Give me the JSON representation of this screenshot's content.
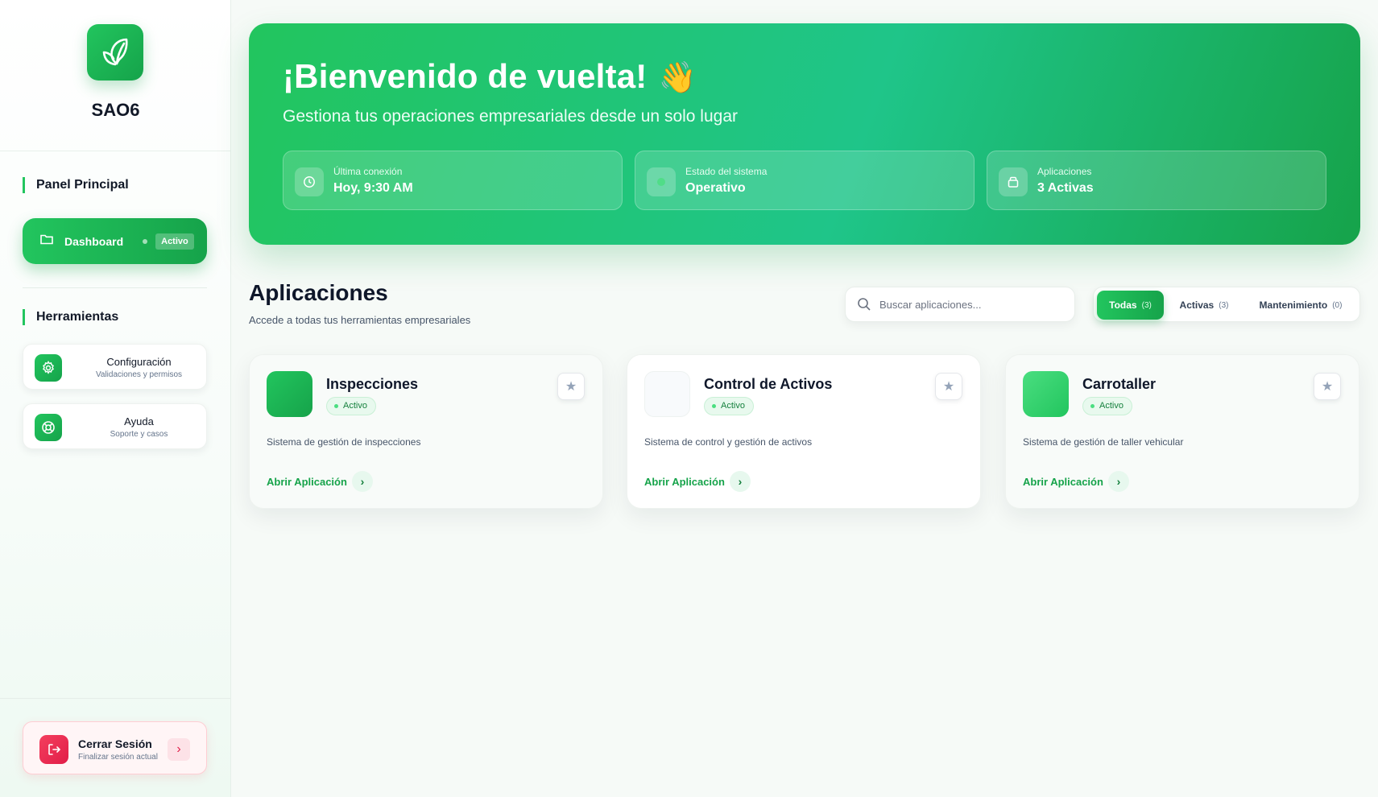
{
  "brand": {
    "name": "SAO6",
    "logo_icon": "leaf-icon"
  },
  "sidebar": {
    "main_section": "Panel Principal",
    "dashboard": {
      "label": "Dashboard",
      "badge": "Activo",
      "icon": "folder-icon"
    },
    "tools_section": "Herramientas",
    "tools": [
      {
        "title": "Configuración",
        "subtitle": "Validaciones y permisos",
        "icon": "gear-icon"
      },
      {
        "title": "Ayuda",
        "subtitle": "Soporte y casos",
        "icon": "lifebuoy-icon"
      }
    ],
    "logout": {
      "title": "Cerrar Sesión",
      "subtitle": "Finalizar sesión actual",
      "icon": "logout-icon",
      "arrow": "›"
    }
  },
  "hero": {
    "title": "¡Bienvenido de vuelta!",
    "wave": "👋",
    "subtitle": "Gestiona tus operaciones empresariales desde un solo lugar",
    "stats": [
      {
        "label": "Última conexión",
        "value": "Hoy, 9:30 AM",
        "icon": "clock-icon"
      },
      {
        "label": "Estado del sistema",
        "value": "Operativo",
        "icon": "status-dot-icon"
      },
      {
        "label": "Aplicaciones",
        "value": "3 Activas",
        "icon": "box-icon"
      }
    ]
  },
  "apps": {
    "title": "Aplicaciones",
    "subtitle": "Accede a todas tus herramientas empresariales",
    "search_placeholder": "Buscar aplicaciones...",
    "filters": [
      {
        "label": "Todas",
        "count": "(3)"
      },
      {
        "label": "Activas",
        "count": "(3)"
      },
      {
        "label": "Mantenimiento",
        "count": "(0)"
      }
    ],
    "cards": [
      {
        "name": "Inspecciones",
        "status": "Activo",
        "description": "Sistema de gestión de inspecciones",
        "action": "Abrir Aplicación",
        "color": "#16a34a"
      },
      {
        "name": "Control de Activos",
        "status": "Activo",
        "description": "Sistema de control y gestión de activos",
        "action": "Abrir Aplicación",
        "color": "#f8fafc"
      },
      {
        "name": "Carrotaller",
        "status": "Activo",
        "description": "Sistema de gestión de taller vehicular",
        "action": "Abrir Aplicación",
        "color": "#4ade80"
      }
    ]
  },
  "colors": {
    "accent": "#22c55e",
    "accent_dark": "#16a34a",
    "danger": "#e11d48"
  }
}
